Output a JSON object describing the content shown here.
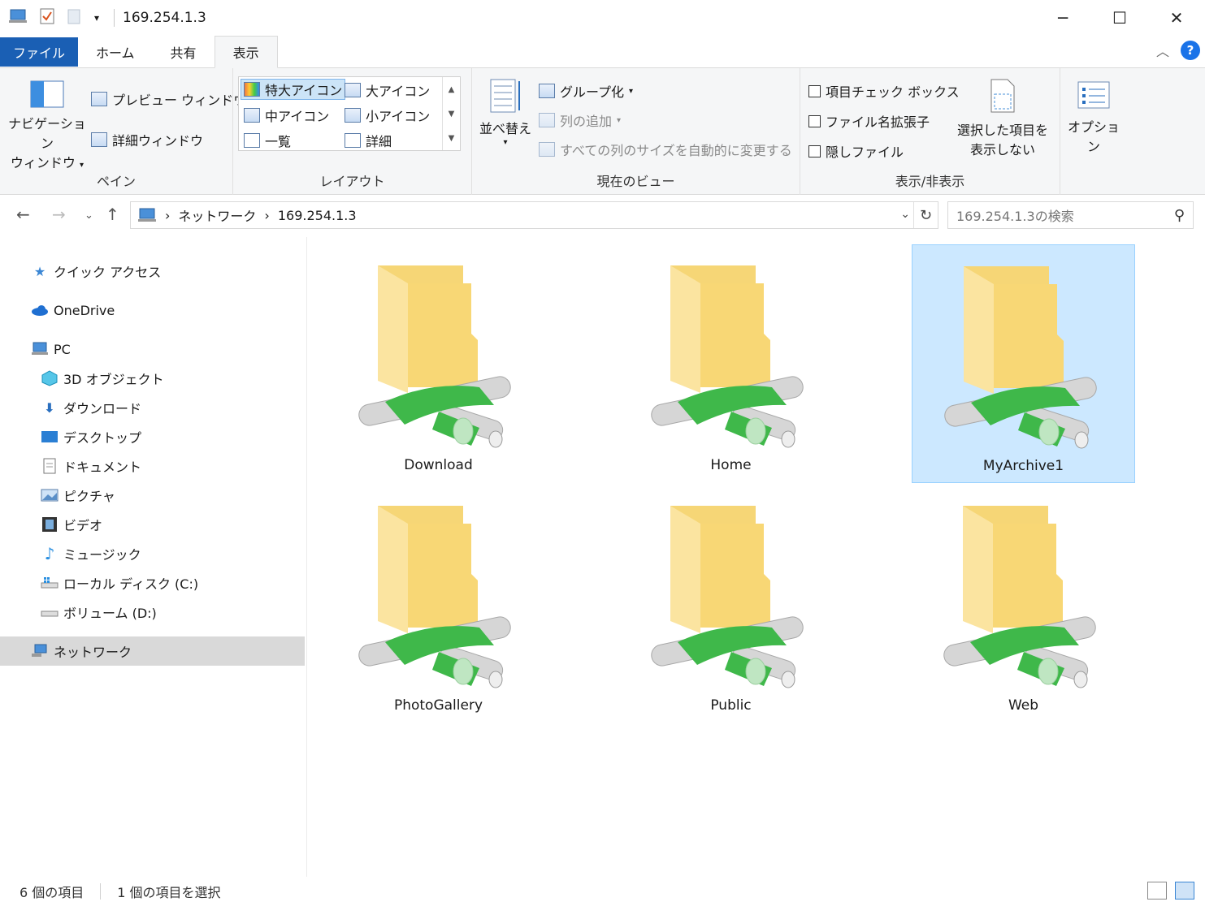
{
  "window": {
    "title": "169.254.1.3",
    "minimize": "─",
    "maximize": "☐",
    "close": "✕"
  },
  "tabs": [
    {
      "label": "ファイル"
    },
    {
      "label": "ホーム"
    },
    {
      "label": "共有"
    },
    {
      "label": "表示"
    }
  ],
  "ribbon": {
    "pane": {
      "label": "ペイン",
      "nav_pane_line1": "ナビゲーション",
      "nav_pane_line2": "ウィンドウ",
      "preview": "プレビュー ウィンドウ",
      "details": "詳細ウィンドウ"
    },
    "layout": {
      "label": "レイアウト",
      "items": [
        "特大アイコン",
        "大アイコン",
        "中アイコン",
        "小アイコン",
        "一覧",
        "詳細"
      ]
    },
    "current_view": {
      "label": "現在のビュー",
      "sort": "並べ替え",
      "group": "グループ化",
      "add_column": "列の追加",
      "autosize": "すべての列のサイズを自動的に変更する"
    },
    "show_hide": {
      "label": "表示/非表示",
      "item_checkbox": "項目チェック ボックス",
      "extensions": "ファイル名拡張子",
      "hidden": "隠しファイル",
      "hide_selected_line1": "選択した項目を",
      "hide_selected_line2": "表示しない"
    },
    "options": "オプション"
  },
  "address": {
    "crumbs": [
      "ネットワーク",
      "169.254.1.3"
    ],
    "search_placeholder": "169.254.1.3の検索"
  },
  "nav": {
    "quick_access": "クイック アクセス",
    "onedrive": "OneDrive",
    "pc": "PC",
    "objects3d": "3D オブジェクト",
    "downloads": "ダウンロード",
    "desktop": "デスクトップ",
    "documents": "ドキュメント",
    "pictures": "ピクチャ",
    "videos": "ビデオ",
    "music": "ミュージック",
    "local_disk": "ローカル ディスク (C:)",
    "volume_d": "ボリューム (D:)",
    "network": "ネットワーク"
  },
  "items": [
    {
      "name": "Download",
      "selected": false
    },
    {
      "name": "Home",
      "selected": false
    },
    {
      "name": "MyArchive1",
      "selected": true
    },
    {
      "name": "PhotoGallery",
      "selected": false
    },
    {
      "name": "Public",
      "selected": false
    },
    {
      "name": "Web",
      "selected": false
    }
  ],
  "status": {
    "count": "6 個の項目",
    "selected": "1 個の項目を選択"
  }
}
